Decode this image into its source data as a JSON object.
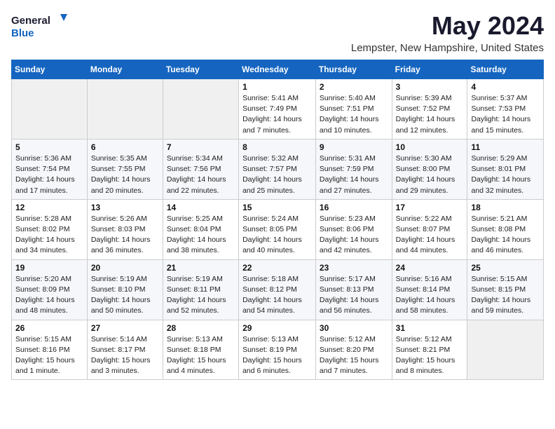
{
  "header": {
    "logo_line1": "General",
    "logo_line2": "Blue",
    "title": "May 2024",
    "location": "Lempster, New Hampshire, United States"
  },
  "weekdays": [
    "Sunday",
    "Monday",
    "Tuesday",
    "Wednesday",
    "Thursday",
    "Friday",
    "Saturday"
  ],
  "weeks": [
    [
      {
        "num": "",
        "empty": true
      },
      {
        "num": "",
        "empty": true
      },
      {
        "num": "",
        "empty": true
      },
      {
        "num": "1",
        "info": "Sunrise: 5:41 AM\nSunset: 7:49 PM\nDaylight: 14 hours\nand 7 minutes."
      },
      {
        "num": "2",
        "info": "Sunrise: 5:40 AM\nSunset: 7:51 PM\nDaylight: 14 hours\nand 10 minutes."
      },
      {
        "num": "3",
        "info": "Sunrise: 5:39 AM\nSunset: 7:52 PM\nDaylight: 14 hours\nand 12 minutes."
      },
      {
        "num": "4",
        "info": "Sunrise: 5:37 AM\nSunset: 7:53 PM\nDaylight: 14 hours\nand 15 minutes."
      }
    ],
    [
      {
        "num": "5",
        "info": "Sunrise: 5:36 AM\nSunset: 7:54 PM\nDaylight: 14 hours\nand 17 minutes."
      },
      {
        "num": "6",
        "info": "Sunrise: 5:35 AM\nSunset: 7:55 PM\nDaylight: 14 hours\nand 20 minutes."
      },
      {
        "num": "7",
        "info": "Sunrise: 5:34 AM\nSunset: 7:56 PM\nDaylight: 14 hours\nand 22 minutes."
      },
      {
        "num": "8",
        "info": "Sunrise: 5:32 AM\nSunset: 7:57 PM\nDaylight: 14 hours\nand 25 minutes."
      },
      {
        "num": "9",
        "info": "Sunrise: 5:31 AM\nSunset: 7:59 PM\nDaylight: 14 hours\nand 27 minutes."
      },
      {
        "num": "10",
        "info": "Sunrise: 5:30 AM\nSunset: 8:00 PM\nDaylight: 14 hours\nand 29 minutes."
      },
      {
        "num": "11",
        "info": "Sunrise: 5:29 AM\nSunset: 8:01 PM\nDaylight: 14 hours\nand 32 minutes."
      }
    ],
    [
      {
        "num": "12",
        "info": "Sunrise: 5:28 AM\nSunset: 8:02 PM\nDaylight: 14 hours\nand 34 minutes."
      },
      {
        "num": "13",
        "info": "Sunrise: 5:26 AM\nSunset: 8:03 PM\nDaylight: 14 hours\nand 36 minutes."
      },
      {
        "num": "14",
        "info": "Sunrise: 5:25 AM\nSunset: 8:04 PM\nDaylight: 14 hours\nand 38 minutes."
      },
      {
        "num": "15",
        "info": "Sunrise: 5:24 AM\nSunset: 8:05 PM\nDaylight: 14 hours\nand 40 minutes."
      },
      {
        "num": "16",
        "info": "Sunrise: 5:23 AM\nSunset: 8:06 PM\nDaylight: 14 hours\nand 42 minutes."
      },
      {
        "num": "17",
        "info": "Sunrise: 5:22 AM\nSunset: 8:07 PM\nDaylight: 14 hours\nand 44 minutes."
      },
      {
        "num": "18",
        "info": "Sunrise: 5:21 AM\nSunset: 8:08 PM\nDaylight: 14 hours\nand 46 minutes."
      }
    ],
    [
      {
        "num": "19",
        "info": "Sunrise: 5:20 AM\nSunset: 8:09 PM\nDaylight: 14 hours\nand 48 minutes."
      },
      {
        "num": "20",
        "info": "Sunrise: 5:19 AM\nSunset: 8:10 PM\nDaylight: 14 hours\nand 50 minutes."
      },
      {
        "num": "21",
        "info": "Sunrise: 5:19 AM\nSunset: 8:11 PM\nDaylight: 14 hours\nand 52 minutes."
      },
      {
        "num": "22",
        "info": "Sunrise: 5:18 AM\nSunset: 8:12 PM\nDaylight: 14 hours\nand 54 minutes."
      },
      {
        "num": "23",
        "info": "Sunrise: 5:17 AM\nSunset: 8:13 PM\nDaylight: 14 hours\nand 56 minutes."
      },
      {
        "num": "24",
        "info": "Sunrise: 5:16 AM\nSunset: 8:14 PM\nDaylight: 14 hours\nand 58 minutes."
      },
      {
        "num": "25",
        "info": "Sunrise: 5:15 AM\nSunset: 8:15 PM\nDaylight: 14 hours\nand 59 minutes."
      }
    ],
    [
      {
        "num": "26",
        "info": "Sunrise: 5:15 AM\nSunset: 8:16 PM\nDaylight: 15 hours\nand 1 minute."
      },
      {
        "num": "27",
        "info": "Sunrise: 5:14 AM\nSunset: 8:17 PM\nDaylight: 15 hours\nand 3 minutes."
      },
      {
        "num": "28",
        "info": "Sunrise: 5:13 AM\nSunset: 8:18 PM\nDaylight: 15 hours\nand 4 minutes."
      },
      {
        "num": "29",
        "info": "Sunrise: 5:13 AM\nSunset: 8:19 PM\nDaylight: 15 hours\nand 6 minutes."
      },
      {
        "num": "30",
        "info": "Sunrise: 5:12 AM\nSunset: 8:20 PM\nDaylight: 15 hours\nand 7 minutes."
      },
      {
        "num": "31",
        "info": "Sunrise: 5:12 AM\nSunset: 8:21 PM\nDaylight: 15 hours\nand 8 minutes."
      },
      {
        "num": "",
        "empty": true
      }
    ]
  ]
}
